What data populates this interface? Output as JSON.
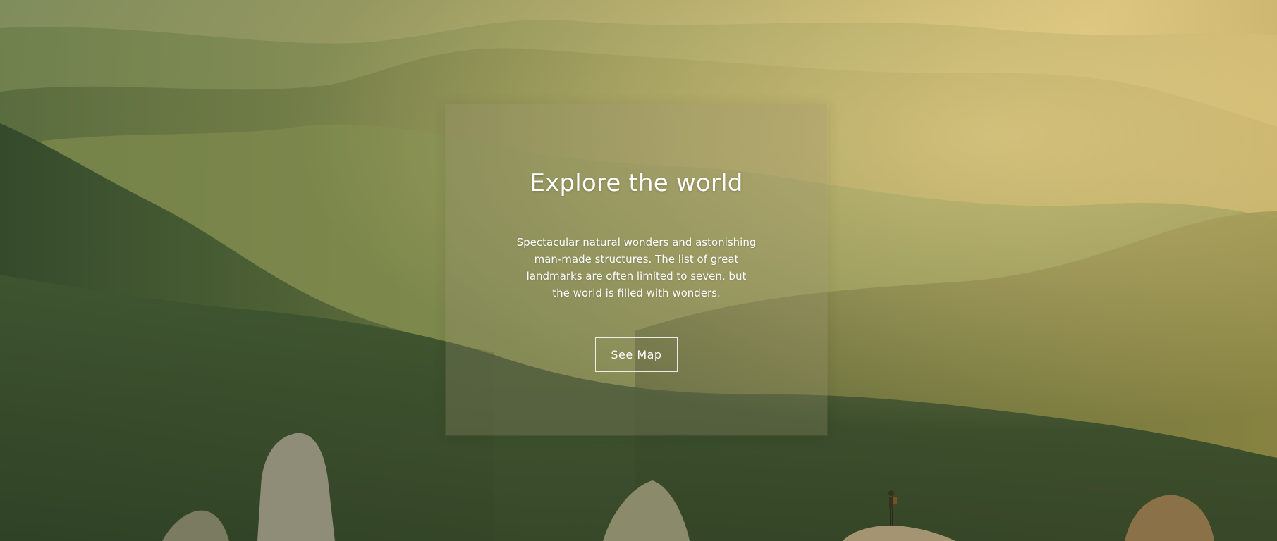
{
  "hero": {
    "title": "Explore the world",
    "description": "Spectacular natural wonders and astonishing man-made structures. The list of great landmarks are often limited to seven, but the world is filled with wonders.",
    "button_label": "See Map"
  },
  "colors": {
    "sky_haze": "#c9b46c",
    "forest_dark": "#3c5230",
    "card_tint": "#96916e",
    "text": "#ffffff"
  }
}
